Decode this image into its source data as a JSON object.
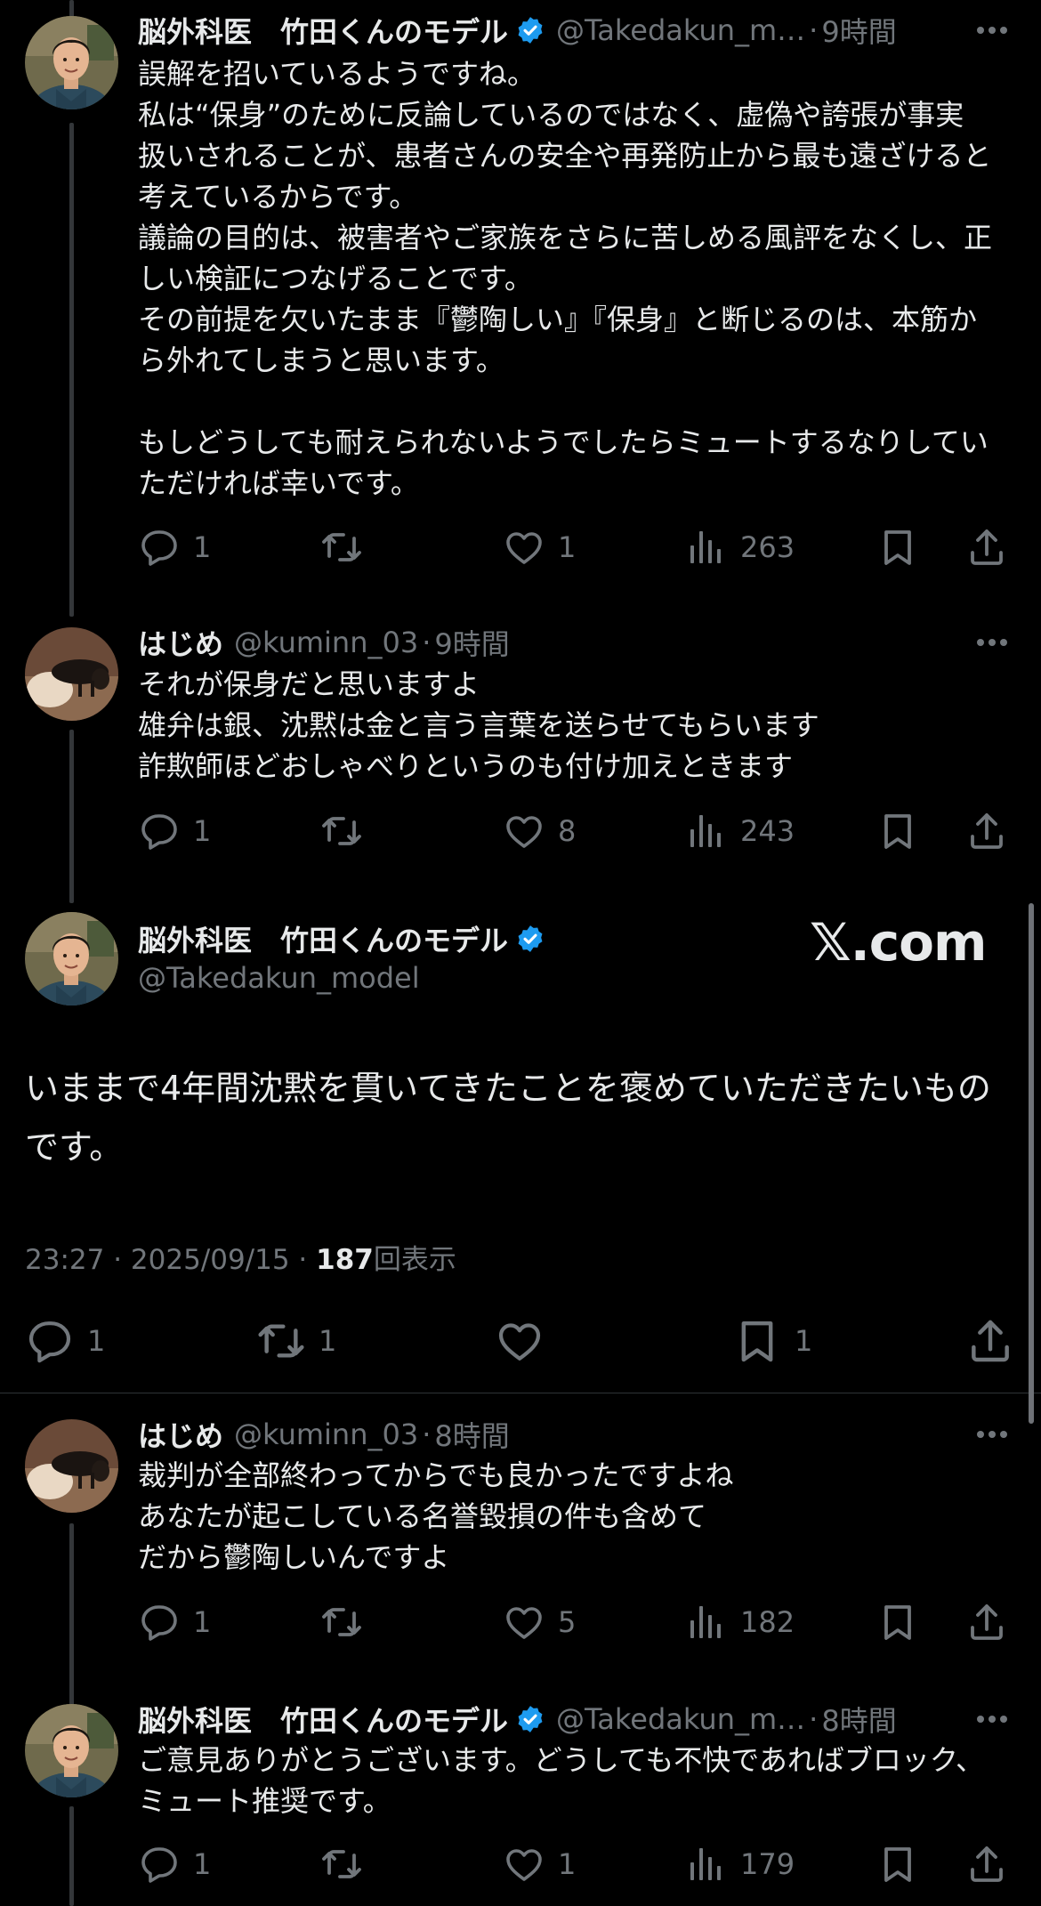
{
  "posts": [
    {
      "name": "脳外科医　竹田くんのモデル",
      "handle": "@Takedakun_m…",
      "time": "9時間",
      "text": "誤解を招いているようですね。\n私は“保身”のために反論しているのではなく、虚偽や誇張が事実扱いされることが、患者さんの安全や再発防止から最も遠ざけると考えているからです。\n議論の目的は、被害者やご家族をさらに苦しめる風評をなくし、正しい検証につなげることです。\nその前提を欠いたまま『鬱陶しい』『保身』と断じるのは、本筋から外れてしまうと思います。\n\nもしどうしても耐えられないようでしたらミュートするなりしていただければ幸いです。",
      "replies": "1",
      "reposts": "",
      "likes": "1",
      "views": "263"
    },
    {
      "name": "はじめ",
      "handle": "@kuminn_03",
      "time": "9時間",
      "text": "それが保身だと思いますよ\n雄弁は銀、沈黙は金と言う言葉を送らせてもらいます\n詐欺師ほどおしゃべりというのも付け加えときます",
      "replies": "1",
      "reposts": "",
      "likes": "8",
      "views": "243"
    },
    {
      "name": "はじめ",
      "handle": "@kuminn_03",
      "time": "8時間",
      "text": "裁判が全部終わってからでも良かったですよね\nあなたが起こしている名誉毀損の件も含めて\nだから鬱陶しいんですよ",
      "replies": "1",
      "reposts": "",
      "likes": "5",
      "views": "182"
    },
    {
      "name": "脳外科医　竹田くんのモデル",
      "handle": "@Takedakun_m…",
      "time": "8時間",
      "text": "ご意見ありがとうございます。どうしても不快であればブロック、ミュート推奨です。",
      "replies": "1",
      "reposts": "",
      "likes": "1",
      "views": "179"
    }
  ],
  "main_post": {
    "name": "脳外科医　竹田くんのモデル",
    "handle": "@Takedakun_model",
    "watermark": "𝕏.com",
    "text": "いままで4年間沈黙を貫いてきたことを褒めていただきたいものです。",
    "timestamp": "23:27 · 2025/09/15 · ",
    "views_count": "187",
    "views_label": "回表示",
    "replies": "1",
    "reposts": "1",
    "likes": "",
    "bookmarks": "1"
  },
  "separator": "·",
  "colors": {
    "background": "#000000",
    "text": "#e7e9ea",
    "muted": "#71767b",
    "verified": "#1d9bf0"
  }
}
